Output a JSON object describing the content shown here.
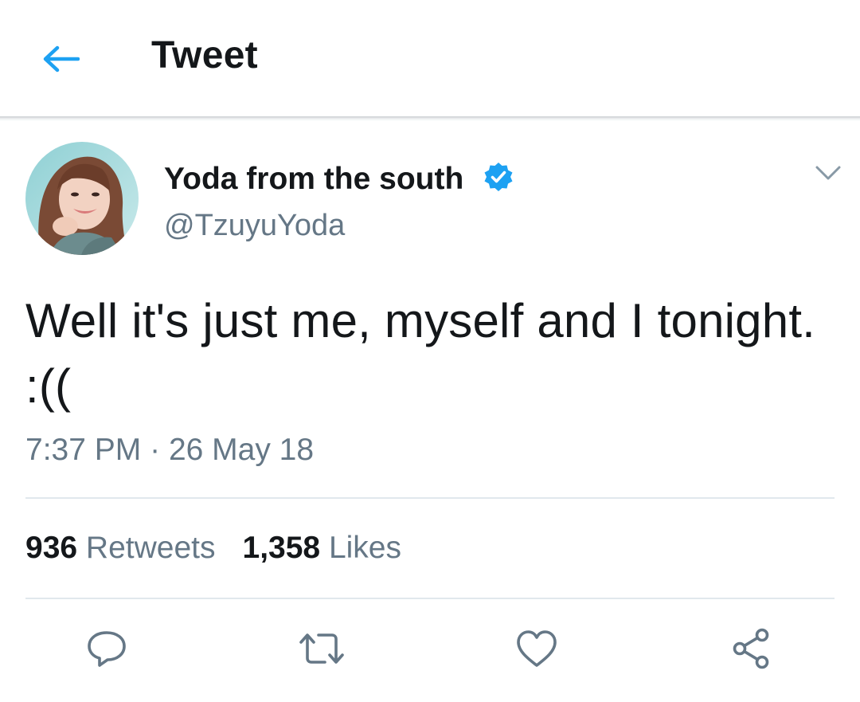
{
  "header": {
    "title": "Tweet",
    "back_icon": "arrow-left-icon",
    "accent_color": "#1da1f2"
  },
  "tweet": {
    "author": {
      "display_name": "Yoda from the south",
      "handle": "@TzuyuYoda",
      "verified": true,
      "verified_icon": "verified-badge-icon"
    },
    "text": "Well it's just me, myself and I tonight. :((",
    "time": "7:37 PM",
    "separator": "·",
    "date": "26 May 18",
    "stats": {
      "retweets_count": "936",
      "retweets_label": "Retweets",
      "likes_count": "1,358",
      "likes_label": "Likes"
    },
    "actions": [
      {
        "icon": "reply-icon"
      },
      {
        "icon": "retweet-icon"
      },
      {
        "icon": "heart-icon"
      },
      {
        "icon": "share-icon"
      }
    ]
  },
  "colors": {
    "text_primary": "#14171a",
    "text_secondary": "#657786",
    "divider": "#e1e8ed",
    "icon_gray": "#657786"
  }
}
